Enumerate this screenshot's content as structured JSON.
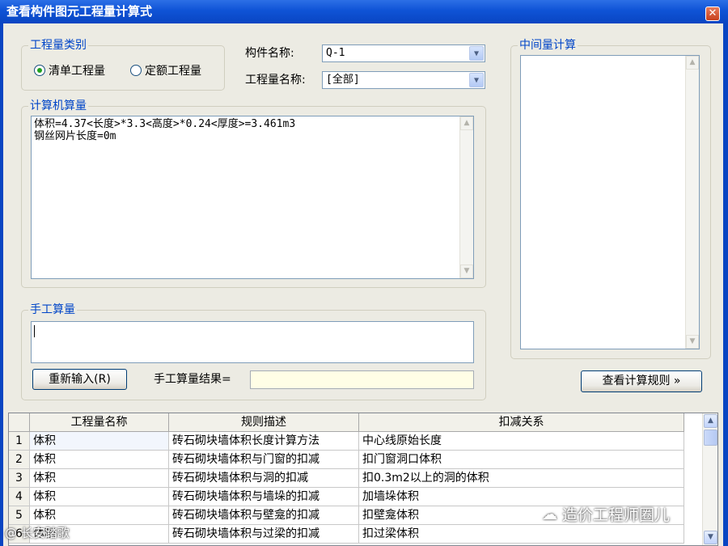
{
  "window": {
    "title": "查看构件图元工程量计算式",
    "close_glyph": "✕"
  },
  "quantity_type": {
    "title": "工程量类别",
    "options": [
      {
        "label": "清单工程量",
        "checked": true
      },
      {
        "label": "定额工程量",
        "checked": false
      }
    ]
  },
  "component": {
    "name_label": "构件名称:",
    "name_value": "Q-1",
    "qty_label": "工程量名称:",
    "qty_value": "[全部]"
  },
  "computer_calc": {
    "title": "计算机算量",
    "lines": [
      "体积=4.37<长度>*3.3<高度>*0.24<厚度>=3.461m3",
      "钢丝网片长度=0m"
    ]
  },
  "manual_calc": {
    "title": "手工算量",
    "reenter_label": "重新输入(R)",
    "result_label": "手工算量结果=",
    "result_value": ""
  },
  "intermediate": {
    "title": "中间量计算"
  },
  "view_rules_label": "查看计算规则 »",
  "rules_table": {
    "headers": [
      "",
      "工程量名称",
      "规则描述",
      "扣减关系"
    ],
    "rows": [
      [
        "1",
        "体积",
        "砖石砌块墙体积长度计算方法",
        "中心线原始长度"
      ],
      [
        "2",
        "体积",
        "砖石砌块墙体积与门窗的扣减",
        "扣门窗洞口体积"
      ],
      [
        "3",
        "体积",
        "砖石砌块墙体积与洞的扣减",
        "扣0.3m2以上的洞的体积"
      ],
      [
        "4",
        "体积",
        "砖石砌块墙体积与墙垛的扣减",
        "加墙垛体积"
      ],
      [
        "5",
        "体积",
        "砖石砌块墙体积与壁龛的扣减",
        "扣壁龛体积"
      ],
      [
        "6",
        "体积",
        "砖石砌块墙体积与过梁的扣减",
        "扣过梁体积"
      ]
    ]
  },
  "watermark": {
    "right": "造价工程师圈儿",
    "left": "@ 长安踏歌"
  },
  "colors": {
    "title_bar": "#0f53d6",
    "group_title": "#0045c8",
    "dialog_bg": "#ecebe3"
  }
}
